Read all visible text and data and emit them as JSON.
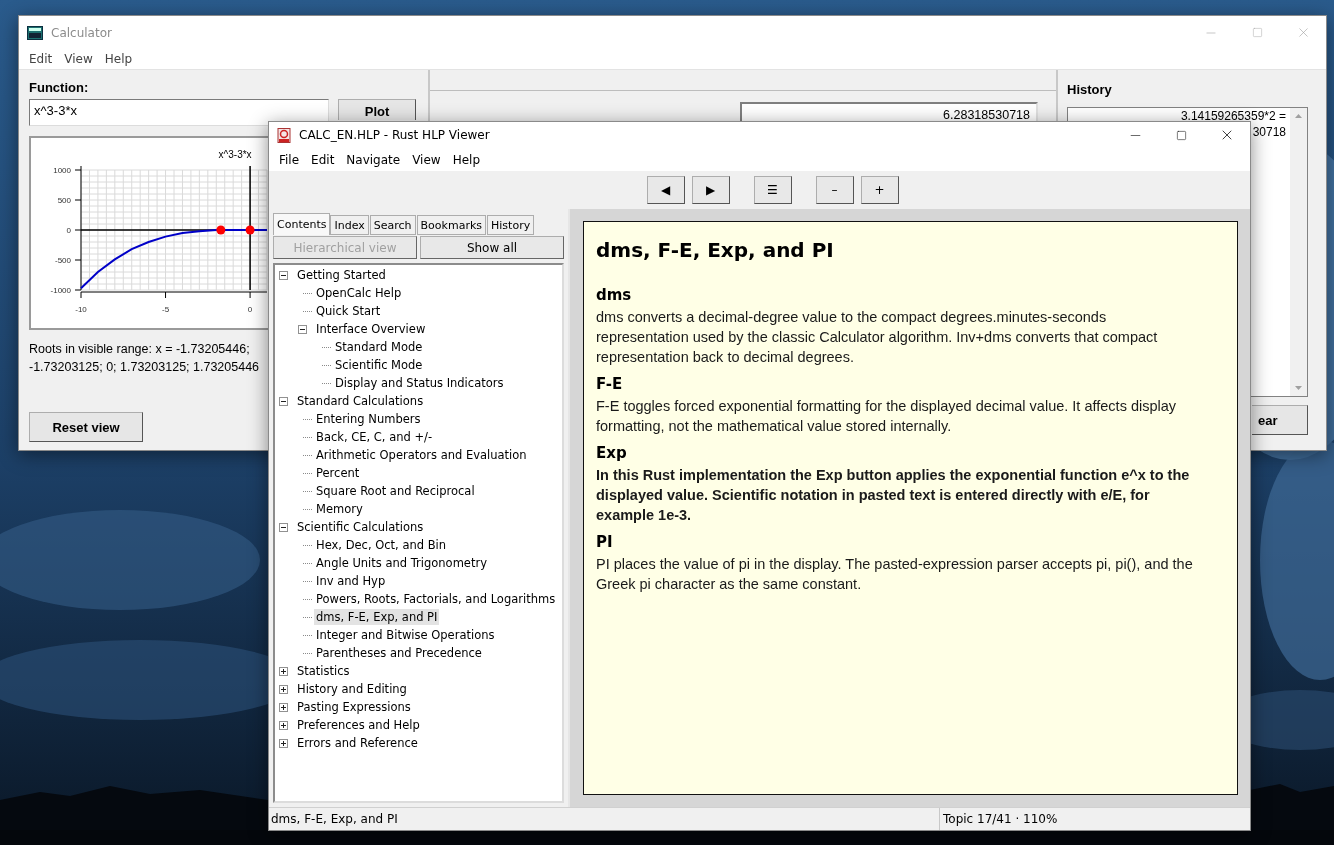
{
  "calculator": {
    "title": "Calculator",
    "menu": [
      "Edit",
      "View",
      "Help"
    ],
    "function_label": "Function:",
    "function_value": "x^3-3*x",
    "plot_button": "Plot",
    "chart_data": {
      "type": "line",
      "title": "x^3-3*x",
      "x": [
        -10,
        -9,
        -8,
        -7,
        -6,
        -5,
        -4,
        -3,
        -2,
        -1.73,
        -1,
        0,
        1
      ],
      "series": [
        {
          "color": "#0000c8",
          "values": [
            -970,
            -700,
            -490,
            -320,
            -200,
            -110,
            -50,
            -20,
            -2,
            0,
            2,
            0,
            -2
          ]
        }
      ],
      "xlim": [
        -10,
        1
      ],
      "ylim": [
        -1000,
        1000
      ],
      "xticks": [
        -10,
        -5,
        0
      ],
      "yticks": [
        -1000,
        -500,
        0,
        500,
        1000
      ],
      "grid": true
    },
    "roots_text": "Roots in visible range: x = -1.73205446; -1.73203125; 0; 1.73203125; 1.73205446",
    "reset_button": "Reset view",
    "display": "6.28318530718",
    "history_title": "History",
    "history": [
      "3.14159265359*2 =",
      "30718"
    ],
    "clear_button": "ear"
  },
  "viewer": {
    "title": "CALC_EN.HLP - Rust HLP Viewer",
    "menu": [
      "File",
      "Edit",
      "Navigate",
      "View",
      "Help"
    ],
    "toolbar": [
      {
        "label": "◀",
        "gap_before": false
      },
      {
        "label": "▶",
        "gap_before": false
      },
      {
        "label": "☰",
        "gap_before": true
      },
      {
        "label": "–",
        "gap_before": true
      },
      {
        "label": "+",
        "gap_before": false
      }
    ],
    "tabs": [
      {
        "label": "Contents",
        "selected": true
      },
      {
        "label": "Index",
        "selected": false
      },
      {
        "label": "Search",
        "selected": false
      },
      {
        "label": "Bookmarks",
        "selected": false
      },
      {
        "label": "History",
        "selected": false
      }
    ],
    "view_buttons": [
      {
        "label": "Hierarchical view",
        "disabled": true
      },
      {
        "label": "Show all",
        "disabled": false
      }
    ],
    "tree": [
      {
        "label": "Getting Started",
        "expanded": true,
        "selected": false,
        "children": [
          {
            "label": "OpenCalc Help",
            "selected": false
          },
          {
            "label": "Quick Start",
            "selected": false
          },
          {
            "label": "Interface Overview",
            "expanded": true,
            "selected": false,
            "children": [
              {
                "label": "Standard Mode",
                "selected": false
              },
              {
                "label": "Scientific Mode",
                "selected": false
              },
              {
                "label": "Display and Status Indicators",
                "selected": false
              }
            ]
          }
        ]
      },
      {
        "label": "Standard Calculations",
        "expanded": true,
        "selected": false,
        "children": [
          {
            "label": "Entering Numbers",
            "selected": false
          },
          {
            "label": "Back, CE, C, and +/-",
            "selected": false
          },
          {
            "label": "Arithmetic Operators and Evaluation",
            "selected": false
          },
          {
            "label": "Percent",
            "selected": false
          },
          {
            "label": "Square Root and Reciprocal",
            "selected": false
          },
          {
            "label": "Memory",
            "selected": false
          }
        ]
      },
      {
        "label": "Scientific Calculations",
        "expanded": true,
        "selected": false,
        "children": [
          {
            "label": "Hex, Dec, Oct, and Bin",
            "selected": false
          },
          {
            "label": "Angle Units and Trigonometry",
            "selected": false
          },
          {
            "label": "Inv and Hyp",
            "selected": false
          },
          {
            "label": "Powers, Roots, Factorials, and Logarithms",
            "selected": false
          },
          {
            "label": "dms, F-E, Exp, and PI",
            "selected": true
          },
          {
            "label": "Integer and Bitwise Operations",
            "selected": false
          },
          {
            "label": "Parentheses and Precedence",
            "selected": false
          }
        ]
      },
      {
        "label": "Statistics",
        "expanded": false,
        "selected": false
      },
      {
        "label": "History and Editing",
        "expanded": false,
        "selected": false
      },
      {
        "label": "Pasting Expressions",
        "expanded": false,
        "selected": false
      },
      {
        "label": "Preferences and Help",
        "expanded": false,
        "selected": false
      },
      {
        "label": "Errors and Reference",
        "expanded": false,
        "selected": false
      }
    ],
    "topic": {
      "title": "dms, F-E, Exp, and PI",
      "sections": [
        {
          "heading": "dms",
          "text": "dms converts a decimal-degree value to the compact degrees.minutes-seconds representation used by the classic Calculator algorithm. Inv+dms converts that compact representation back to decimal degrees.",
          "bold": false
        },
        {
          "heading": "F-E",
          "text": "F-E toggles forced exponential formatting for the displayed decimal value. It affects display formatting, not the mathematical value stored internally.",
          "bold": false
        },
        {
          "heading": "Exp",
          "text": "In this Rust implementation the Exp button applies the exponential function e^x to the displayed value. Scientific notation in pasted text is entered directly with e/E, for example 1e-3.",
          "bold": true
        },
        {
          "heading": "PI",
          "text": "PI places the value of pi in the display. The pasted-expression parser accepts pi, pi(), and the Greek pi character as the same constant.",
          "bold": false
        }
      ]
    },
    "status": {
      "topic": "dms, F-E, Exp, and PI",
      "position": "Topic 17/41 · 110%"
    }
  }
}
